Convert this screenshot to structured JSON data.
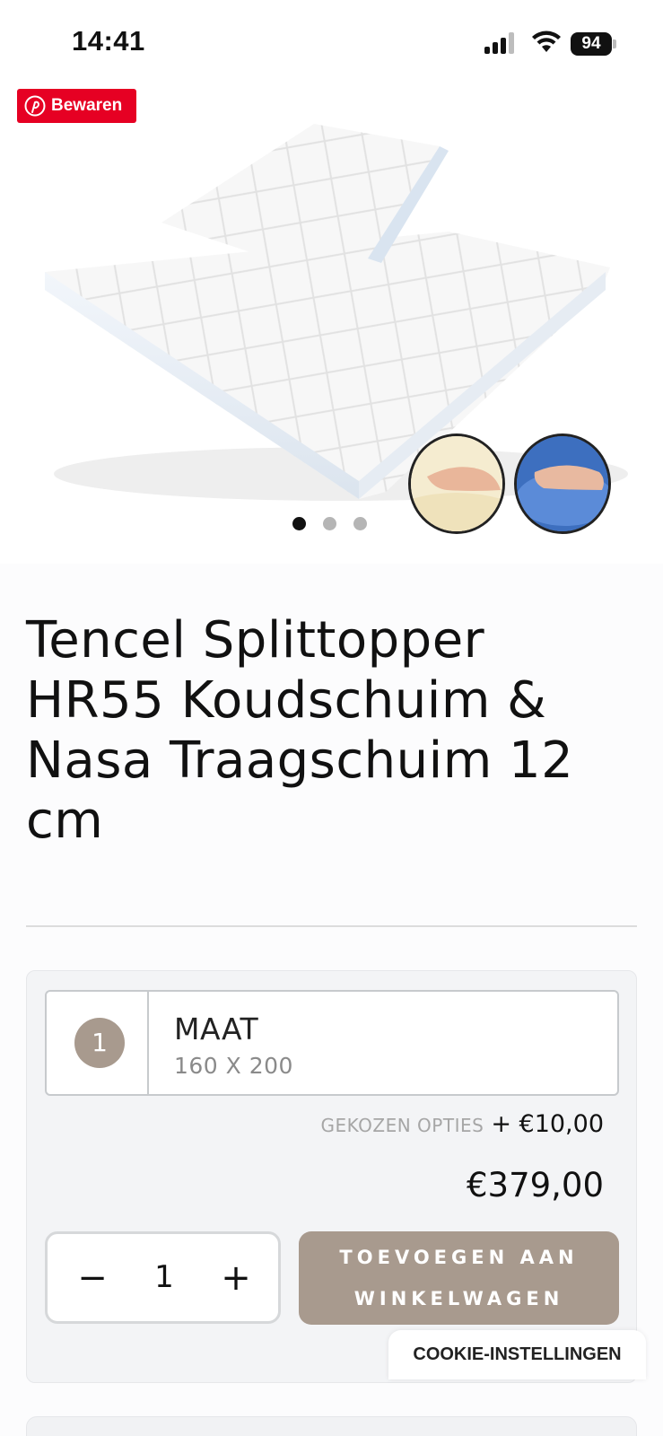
{
  "status_bar": {
    "time": "14:41",
    "battery": "94"
  },
  "gallery": {
    "save_label": "Bewaren",
    "slide_count": 3,
    "active_slide": 1,
    "pinterest_color": "#e60023"
  },
  "product": {
    "title": "Tencel Splittopper HR55 Koudschuim & Nasa Traagschuim 12 cm"
  },
  "options": {
    "step_number": "1",
    "label": "MAAT",
    "value": "160 X 200",
    "chosen_label": "GEKOZEN OPTIES",
    "chosen_price": "+ €10,00",
    "total_price": "€379,00"
  },
  "cart": {
    "quantity": "1",
    "minus_symbol": "−",
    "plus_symbol": "+",
    "add_button_label": "TOEVOEGEN AAN WINKELWAGEN",
    "accent_color": "#a89a8e"
  },
  "cookie": {
    "label": "COOKIE-INSTELLINGEN"
  }
}
